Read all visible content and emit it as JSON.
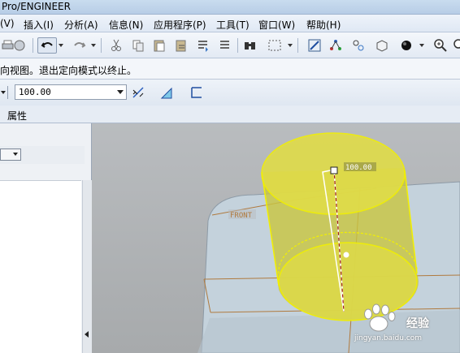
{
  "window": {
    "title": "Pro/ENGINEER"
  },
  "menu": {
    "items": [
      "(V)",
      "插入(I)",
      "分析(A)",
      "信息(N)",
      "应用程序(P)",
      "工具(T)",
      "窗口(W)",
      "帮助(H)"
    ]
  },
  "toolbar": {
    "icons": [
      "print-icon",
      "undo-icon",
      "redo-icon",
      "cut-icon",
      "copy-icon",
      "paste-icon",
      "regenerate-icon",
      "find-icon",
      "select-box-icon",
      "sketch-icon",
      "datum-icon",
      "analysis-icon",
      "view-icon",
      "appearance-icon",
      "zoom-in-icon"
    ]
  },
  "message": {
    "text": "向视图。退出定向模式以终止。"
  },
  "dashboard": {
    "dimension_value": "100.00",
    "options": [
      "flip-direction",
      "thicken",
      "surface"
    ]
  },
  "tabs": {
    "properties": "属性"
  },
  "viewport": {
    "datum_label": "FRONT",
    "dimension_label": "100.00",
    "colors": {
      "feature_fill": "#d8d63a",
      "feature_edge": "#f2f000",
      "datum": "#b07a3e",
      "part": "#c9d6df"
    }
  },
  "watermark": {
    "text": "经验",
    "url": "jingyan.baidu.com"
  }
}
